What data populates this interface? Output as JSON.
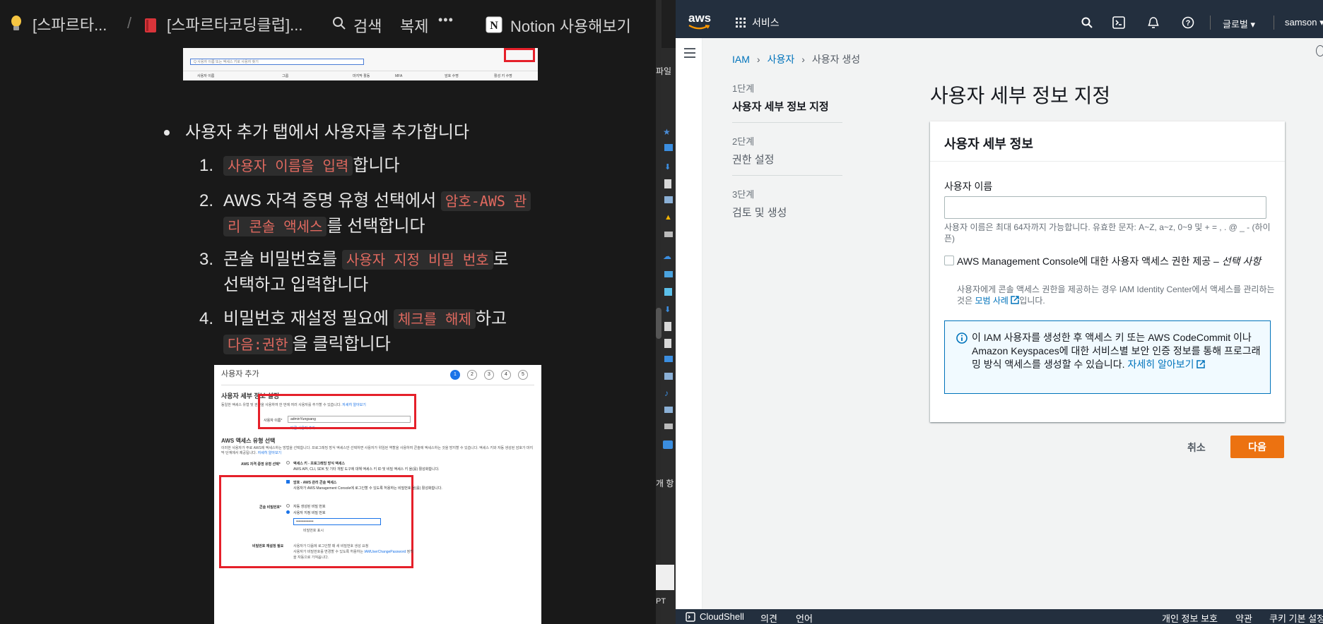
{
  "notion": {
    "breadcrumb": [
      {
        "icon": "lightbulb-icon",
        "label": "[스파르타..."
      },
      {
        "icon": "book-icon",
        "label": "[스파르타코딩클럽]..."
      }
    ],
    "breadcrumb_sep": "/",
    "search_label": "검색",
    "duplicate_label": "복제",
    "more_label": "•••",
    "cta_label": "Notion 사용해보기",
    "bullet_text": "사용자 추가 탭에서 사용자를 추가합니다",
    "steps": [
      {
        "num": "1.",
        "code": "사용자 이름을 입력",
        "after": "합니다"
      },
      {
        "num": "2.",
        "pre": "AWS 자격 증명 유형 선택에서 ",
        "code1": "암호-AWS 관",
        "code2": "리 콘솔 액세스",
        "after": "를 선택합니다"
      },
      {
        "num": "3.",
        "pre": "콘솔 비밀번호를 ",
        "code": "사용자 지정 비밀 번호",
        "after": "로",
        "line2": "선택하고 입력합니다"
      },
      {
        "num": "4.",
        "pre": "비밀번호 재설정 필요에 ",
        "code1": "체크를 해제",
        "after1": "하고",
        "code2": "다음:권한",
        "after2": "을 클릭합니다"
      }
    ],
    "top_shot": {
      "search_placeholder": "Q 사용자 이름 또는 액세스 키로 사용자 찾기",
      "columns": [
        "사용자 이름",
        "그룹",
        "마지막 활동",
        "MFA",
        "암호 수명",
        "활성 키 수명"
      ]
    },
    "shot": {
      "title": "사용자 추가",
      "steps": [
        "1",
        "2",
        "3",
        "4",
        "5"
      ],
      "section1": "사용자 세부 정보 설정",
      "desc1": "동일한 액세스 유형 및 권한을 사용하여 한 번에 여러 사용자를 추가할 수 있습니다.",
      "desc1_link": "자세히 알아보기",
      "username_label": "사용자 이름*",
      "username_value": "adminYungsang",
      "add_user": "다른 사용자 추가",
      "section2": "AWS 액세스 유형 선택",
      "desc2": "이러한 사용자가 주로 AWS에 액세스하는 방법을 선택합니다. 프로그래밍 방식 액세스만 선택하면 사용자가 위임된 역할을 사용하여 콘솔에 액세스하는 것을 방지할 수 있습니다. 액세스 키와 자동 생성된 암호가 마지막 단계에서 제공됩니다.",
      "desc2_link": "자세히 알아보기",
      "cred_label": "AWS 자격 증명 유형 선택*",
      "opt1": "액세스 키 - 프로그래밍 방식 액세스",
      "opt1_desc": "AWS API, CLI, SDK 및 기타 개발 도구에 대해 액세스 키 ID 및 비밀 액세스 키 을(를) 활성화합니다.",
      "opt2": "암호 - AWS 관리 콘솔 액세스",
      "opt2_desc": "사용자가 AWS Management Console에 로그인할 수 있도록 허용하는 비밀번호 을(를) 활성화합니다.",
      "pw_label": "콘솔 비밀번호*",
      "pw_opt1": "자동 생성된 비밀 번호",
      "pw_opt2": "사용자 지정 비밀 번호",
      "pw_value": "••••••••••••••",
      "show_pw": "비밀번호 표시",
      "reset_label": "비밀번호 재설정 필요",
      "reset_desc1": "사용자가 다음에 로그인할 때 새 비밀번호 생성 요청",
      "reset_desc2": "사용자가 비밀번호를 변경할 수 있도록 허용하는",
      "reset_link": "IAMUserChangePassword",
      "reset_desc3": "정책을 자동으로 가져옵니다."
    }
  },
  "strip": {
    "labels": [
      "파일",
      "개 항",
      "PT"
    ]
  },
  "aws": {
    "logo": "aws",
    "services_label": "서비스",
    "region_label": "글로벌 ▾",
    "user_label": "samson ▾",
    "breadcrumb": [
      "IAM",
      "사용자",
      "사용자 생성"
    ],
    "wizard_steps": [
      {
        "num": "1단계",
        "title": "사용자 세부 정보 지정"
      },
      {
        "num": "2단계",
        "title": "권한 설정"
      },
      {
        "num": "3단계",
        "title": "검토 및 생성"
      }
    ],
    "page_title": "사용자 세부 정보 지정",
    "panel_title": "사용자 세부 정보",
    "username_label": "사용자 이름",
    "username_value": "",
    "username_hint": "사용자 이름은 최대 64자까지 가능합니다. 유효한 문자: A~Z, a~z, 0~9 및 + = , . @ _ - (하이픈)",
    "console_checkbox_label": "AWS Management Console에 대한 사용자 액세스 권한 제공 –",
    "console_checkbox_optional": "선택 사항",
    "console_desc": "사용자에게 콘솔 액세스 권한을 제공하는 경우 IAM Identity Center에서 액세스를 관리하는 것은",
    "console_desc_link": "모범 사례",
    "console_desc_after": "입니다.",
    "info_text": "이 IAM 사용자를 생성한 후 액세스 키 또는 AWS CodeCommit 이나 Amazon Keyspaces에 대한 서비스별 보안 인증 정보를 통해 프로그래밍 방식 액세스를 생성할 수 있습니다.",
    "info_link": "자세히 알아보기",
    "cancel_label": "취소",
    "next_label": "다음",
    "footer": {
      "cloudshell": "CloudShell",
      "feedback": "의견",
      "language": "언어",
      "privacy": "개인 정보 보호",
      "terms": "약관",
      "cookies": "쿠키 기본 설정"
    },
    "accent": "#ec7211",
    "link_color": "#0073bb"
  }
}
